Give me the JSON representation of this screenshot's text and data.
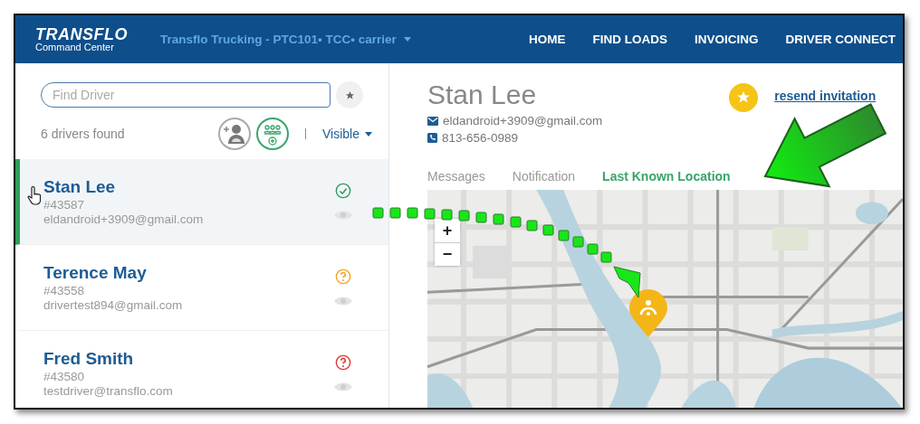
{
  "header": {
    "logo": {
      "title": "TRANSFLO",
      "subtitle": "Command Center"
    },
    "company": "Transflo Trucking - PTC101• TCC• carrier",
    "nav": [
      "HOME",
      "FIND LOADS",
      "INVOICING",
      "DRIVER CONNECT"
    ]
  },
  "sidebar": {
    "search": {
      "placeholder": "Find Driver"
    },
    "count": "6 drivers found",
    "filter": "Visible",
    "drivers": [
      {
        "name": "Stan Lee",
        "id": "#43587",
        "email": "eldandroid+3909@gmail.com",
        "selected": true,
        "kind": "verified",
        "color": "#2e9e5b"
      },
      {
        "name": "Terence May",
        "id": "#43558",
        "email": "drivertest894@gmail.com",
        "selected": false,
        "kind": "pending",
        "color": "#f5a623"
      },
      {
        "name": "Fred Smith",
        "id": "#43580",
        "email": "testdriver@transflo.com",
        "selected": false,
        "kind": "pending",
        "color": "#e53935"
      }
    ]
  },
  "detail": {
    "name": "Stan Lee",
    "link": "resend invitation",
    "email": "eldandroid+3909@gmail.com",
    "phone": "813-656-0989",
    "tabs": [
      {
        "label": "Messages",
        "selected": false
      },
      {
        "label": "Notification",
        "selected": false
      },
      {
        "label": "Last Known Location",
        "selected": true
      }
    ]
  },
  "map": {
    "zoom_in": "+",
    "zoom_out": "−"
  }
}
